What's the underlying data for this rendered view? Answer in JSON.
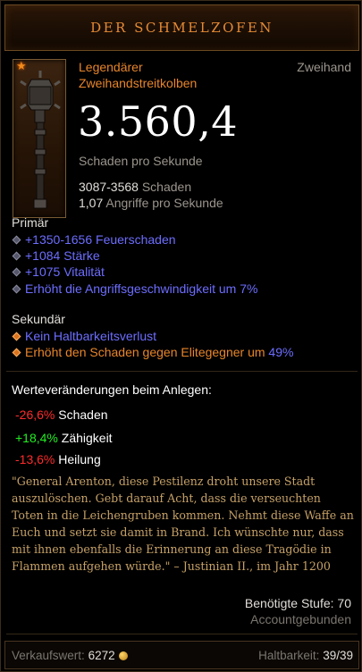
{
  "header": {
    "title": "DER SCHMELZOFEN"
  },
  "item": {
    "quality": "Legendärer",
    "type": "Zweihandstreitkolben",
    "slot": "Zweihand",
    "dps": "3.560,4",
    "dps_label": "Schaden pro Sekunde",
    "damage_range": "3087-3568",
    "damage_label": "Schaden",
    "aps_value": "1,07",
    "aps_label": "Angriffe pro Sekunde"
  },
  "primary": {
    "heading": "Primär",
    "stats": [
      "+1350-1656 Feuerschaden",
      "+1084 Stärke",
      "+1075 Vitalität",
      "Erhöht die Angriffsgeschwindigkeit um 7%"
    ]
  },
  "secondary": {
    "heading": "Sekundär",
    "stats": [
      "Kein Haltbarkeitsverlust",
      "Erhöht den Schaden gegen Elitegegner um"
    ],
    "elite_value": "49%"
  },
  "changes": {
    "heading": "Werteveränderungen beim Anlegen:",
    "rows": [
      {
        "value": "-26,6%",
        "label": "Schaden",
        "color": "#ff2b2b"
      },
      {
        "value": "+18,4%",
        "label": "Zähigkeit",
        "color": "#22ee22"
      },
      {
        "value": "-13,6%",
        "label": "Heilung",
        "color": "#ff2b2b"
      }
    ]
  },
  "flavor": {
    "text": "\"General Arenton, diese Pestilenz droht unsere Stadt auszulöschen. Gebt darauf Acht, dass die verseuchten Toten in die Leichengruben kommen. Nehmt diese Waffe an Euch und setzt sie damit in Brand. Ich wünschte nur, dass mit ihnen ebenfalls die Erinnerung an diese Tragödie in Flammen aufgehen würde.\" – Justinian II., im Jahr 1200"
  },
  "requirements": {
    "level": "Benötigte Stufe: 70",
    "binding": "Accountgebunden"
  },
  "footer": {
    "sell_label": "Verkaufswert:",
    "sell_value": "6272",
    "durability_label": "Haltbarkeit:",
    "durability_value": "39/39"
  },
  "icons": {
    "legendary": "star-icon",
    "weapon": "mace-icon",
    "gold": "coin-icon",
    "bullet": "diamond-bullet-icon"
  },
  "colors": {
    "legendary": "#e8852a",
    "magic": "#6d6dff",
    "flavor": "#c6a167"
  }
}
